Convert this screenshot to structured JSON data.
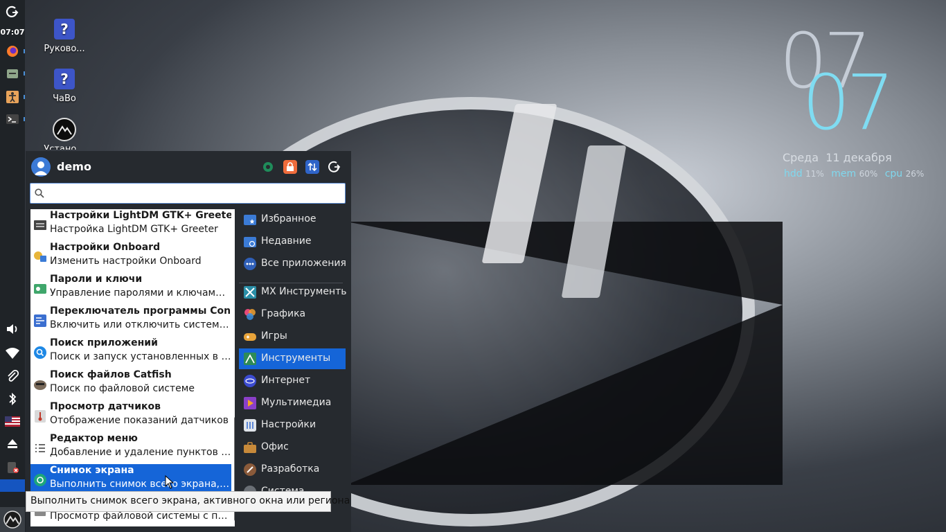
{
  "panel": {
    "clock": "07:07",
    "accent": "#1555c0"
  },
  "desktop": {
    "icons": [
      {
        "label": "Руково...",
        "icon": "help-icon"
      },
      {
        "label": "ЧаВо",
        "icon": "help-icon"
      },
      {
        "label": "Устано...",
        "icon": "mx-installer-icon"
      }
    ]
  },
  "conky": {
    "hour": "07",
    "minute": "07",
    "weekday": "Среда",
    "date": "11 декабря",
    "hdd_label": "hdd",
    "hdd_value": "11%",
    "mem_label": "mem",
    "mem_value": "60%",
    "cpu_label": "cpu",
    "cpu_value": "26%"
  },
  "menu": {
    "username": "demo",
    "search_placeholder": "",
    "apps": [
      {
        "name": "Настройки LightDM GTK+ Greeter",
        "desc": "Настройка LightDM GTK+ Greeter",
        "icon": "lightdm-icon"
      },
      {
        "name": "Настройки Onboard",
        "desc": "Изменить настройки Onboard",
        "icon": "onboard-icon"
      },
      {
        "name": "Пароли и ключи",
        "desc": "Управление паролями и ключами ...",
        "icon": "keys-icon"
      },
      {
        "name": "Переключатель программы Conky",
        "desc": "Включить или отключить системны...",
        "icon": "conky-icon"
      },
      {
        "name": "Поиск приложений",
        "desc": "Поиск и запуск установленных в ва...",
        "icon": "app-finder-icon"
      },
      {
        "name": "Поиск файлов Catfish",
        "desc": "Поиск по файловой системе",
        "icon": "catfish-icon"
      },
      {
        "name": "Просмотр датчиков",
        "desc": "Отображение показаний датчиков",
        "icon": "sensors-icon"
      },
      {
        "name": "Редактор меню",
        "desc": "Добавление и удаление пунктов ме...",
        "icon": "menu-editor-icon"
      },
      {
        "name": "Снимок экрана",
        "desc": "Выполнить снимок всего экрана, ак...",
        "icon": "screenshot-icon"
      },
      {
        "name": "",
        "desc": "Просмотр файловой системы с пом...",
        "icon": "files-icon"
      }
    ],
    "categories": [
      {
        "label": "Избранное",
        "icon": "favorites-icon",
        "color": "#3b7bd6"
      },
      {
        "label": "Недавние",
        "icon": "recent-icon",
        "color": "#3b7bd6"
      },
      {
        "label": "Все приложения",
        "icon": "all-apps-icon",
        "color": "#2f5fb8"
      },
      {
        "label": "MX Инструменты",
        "icon": "mx-tools-icon",
        "color": "#2a8fa8"
      },
      {
        "label": "Графика",
        "icon": "graphics-icon",
        "color": "#d9508a"
      },
      {
        "label": "Игры",
        "icon": "games-icon",
        "color": "#e8a33a"
      },
      {
        "label": "Инструменты",
        "icon": "accessories-icon",
        "color": "#2e8b57"
      },
      {
        "label": "Интернет",
        "icon": "internet-icon",
        "color": "#3b4bd0"
      },
      {
        "label": "Мультимедиа",
        "icon": "multimedia-icon",
        "color": "#8a3fc8"
      },
      {
        "label": "Настройки",
        "icon": "settings-icon",
        "color": "#e0e4ea"
      },
      {
        "label": "Офис",
        "icon": "office-icon",
        "color": "#c88a3a"
      },
      {
        "label": "Разработка",
        "icon": "development-icon",
        "color": "#8a5a3a"
      },
      {
        "label": "Система",
        "icon": "system-icon",
        "color": "#6a6f75"
      }
    ],
    "selected_color": "#1565d8"
  },
  "tooltip": {
    "text": "Выполнить снимок всего экрана, активного окна или региона"
  }
}
